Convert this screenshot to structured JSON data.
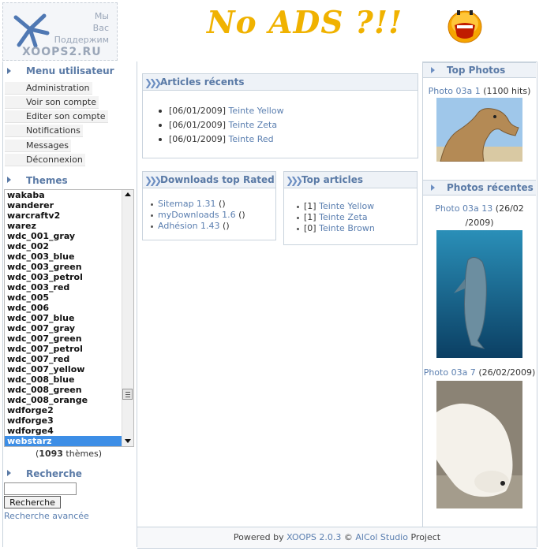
{
  "header": {
    "logo_lines": [
      "Мы",
      "Вас",
      "Поддержим"
    ],
    "logo_site": "XOOPS2.RU",
    "banner_text": "No ADS ?!!"
  },
  "sidebar": {
    "user_menu_title": "Menu utilisateur",
    "user_menu": [
      "Administration",
      "Voir son compte",
      "Editer son compte",
      "Notifications",
      "Messages",
      "Déconnexion"
    ],
    "themes_title": "Themes",
    "themes": [
      "wakaba",
      "wanderer",
      "warcraftv2",
      "warez",
      "wdc_001_gray",
      "wdc_002",
      "wdc_003_blue",
      "wdc_003_green",
      "wdc_003_petrol",
      "wdc_003_red",
      "wdc_005",
      "wdc_006",
      "wdc_007_blue",
      "wdc_007_gray",
      "wdc_007_green",
      "wdc_007_petrol",
      "wdc_007_red",
      "wdc_007_yellow",
      "wdc_008_blue",
      "wdc_008_green",
      "wdc_008_orange",
      "wdforge2",
      "wdforge3",
      "wdforge4",
      "webstarz"
    ],
    "selected_theme": "webstarz",
    "themes_count": "1093",
    "themes_count_suffix": "thèmes",
    "search_title": "Recherche",
    "search_value": "",
    "search_button": "Recherche",
    "advanced_search": "Recherche avancée"
  },
  "articles_recents": {
    "title": "Articles récents",
    "items": [
      {
        "date": "[06/01/2009]",
        "link": "Teinte Yellow"
      },
      {
        "date": "[06/01/2009]",
        "link": "Teinte Zeta"
      },
      {
        "date": "[06/01/2009]",
        "link": "Teinte Red"
      }
    ]
  },
  "downloads": {
    "title": "Downloads top Rated",
    "items": [
      {
        "link": "Sitemap 1.31",
        "extra": "()"
      },
      {
        "link": "myDownloads 1.6",
        "extra": "()"
      },
      {
        "link": "Adhésion 1.43",
        "extra": "()"
      }
    ]
  },
  "top_articles": {
    "title": "Top articles",
    "items": [
      {
        "count": "[1]",
        "link": "Teinte Yellow"
      },
      {
        "count": "[1]",
        "link": "Teinte Zeta"
      },
      {
        "count": "[0]",
        "link": "Teinte Brown"
      }
    ]
  },
  "top_photos": {
    "title": "Top Photos",
    "caption_link": "Photo 03a 1",
    "caption_text": "(1100 hits)"
  },
  "recent_photos": {
    "title": "Photos récentes",
    "photo1_link": "Photo 03a 13",
    "photo1_text_a": "(26/02",
    "photo1_text_b": "/2009)",
    "photo2_link": "Photo 03a 7",
    "photo2_text": "(26/02/2009)"
  },
  "footer": {
    "prefix": "Powered by",
    "xoops": "XOOPS 2.0.3",
    "copy": "©",
    "studio": "AlCol Studio",
    "suffix": "Project"
  },
  "colors": {
    "accent": "#5a7aa6",
    "link": "#5b7fb0",
    "selection": "#3d8ee6",
    "banner": "#f0b200"
  }
}
